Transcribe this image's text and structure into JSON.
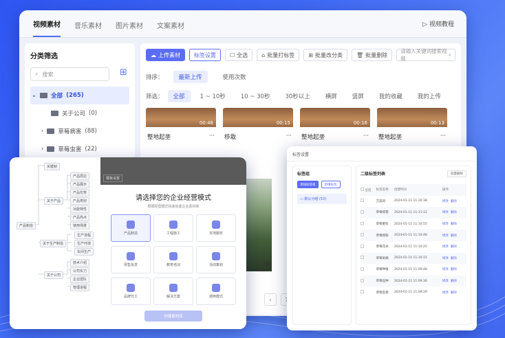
{
  "main": {
    "tabs": [
      "视频素材",
      "音乐素材",
      "图片素材",
      "文案素材"
    ],
    "tutorial": "视频教程",
    "sidebar": {
      "title": "分类筛选",
      "search_placeholder": "搜索",
      "tree": [
        {
          "label": "全部",
          "count": "(265)"
        },
        {
          "label": "关于公司",
          "count": "(0)"
        },
        {
          "label": "草莓病害",
          "count": "(88)"
        },
        {
          "label": "草莓虫害",
          "count": "(22)"
        }
      ]
    },
    "toolbar": {
      "upload": "上传素材",
      "tags": "标签设置",
      "select_all": "全选",
      "batch_tag": "批量打标签",
      "batch_category": "批量改分类",
      "batch_delete": "批量删除",
      "keyword_placeholder": "请输入关键词搜索视频"
    },
    "sort": {
      "label": "排序：",
      "options": [
        "最新上传",
        "使用次数"
      ]
    },
    "filter": {
      "label": "筛选：",
      "options": [
        "全部",
        "1 ~ 10秒",
        "10 ~ 30秒",
        "30秒以上",
        "横屏",
        "竖屏",
        "我的收藏",
        "我的上传"
      ]
    },
    "cards": [
      {
        "name": "整地起垄",
        "duration": "00:46"
      },
      {
        "name": "移栽",
        "duration": "00:15"
      },
      {
        "name": "整地起垄",
        "duration": "00:16"
      },
      {
        "name": "整地起垄",
        "duration": "00:13"
      }
    ],
    "below_text": "果",
    "pager": [
      "‹",
      "1",
      "2"
    ]
  },
  "mind": {
    "root": "产品制造",
    "branches": [
      {
        "label": "关键帧",
        "children": []
      },
      {
        "label": "关于产品",
        "children": [
          "产品周边",
          "产品展示",
          "产品优势",
          "产品类别",
          "功能特性",
          "产品亮点",
          "使用场景"
        ]
      },
      {
        "label": "关于生产制造",
        "children": [
          "生产流程",
          "生产环境",
          "车间生产"
        ]
      },
      {
        "label": "关于公司",
        "children": [
          "技术介绍",
          "公司实力",
          "企业团队",
          "管理进程"
        ]
      }
    ],
    "modal": {
      "header_tag": "模板设置",
      "title": "请选择您的企业经营模式",
      "subtitle": "根据经营模式快速创建企业素材库",
      "options": [
        "产品制造",
        "工程施工",
        "本地服务",
        "零售批发",
        "教育培训",
        "活动策划",
        "品牌代工",
        "解决方案",
        "通用模式"
      ],
      "create": "创建素材库"
    }
  },
  "tags": {
    "title": "标签设置",
    "left_title": "标签组",
    "add_group": "添加标签组",
    "new_tag": "新增标签",
    "group": "默认分组 (53)",
    "right_title": "二级标签列表",
    "batch_delete": "批量删除",
    "columns": [
      "全选",
      "标签名称",
      "创建时间",
      "操作"
    ],
    "rows": [
      {
        "name": "方案同",
        "time": "2024-01-11 11:20:38"
      },
      {
        "name": "草莓病害",
        "time": "2024-01-11 11:11:12"
      },
      {
        "name": "草莓肥料",
        "time": "2024-01-11 11:10:55"
      },
      {
        "name": "草莓授粉",
        "time": "2024-01-11 11:10:48"
      },
      {
        "name": "草莓花朵",
        "time": "2024-01-11 11:10:25"
      },
      {
        "name": "草莓采摘",
        "time": "2024-01-11 11:10:15"
      },
      {
        "name": "草莓种植",
        "time": "2024-01-11 11:09:48"
      },
      {
        "name": "草莓品种",
        "time": "2024-01-11 11:09:36"
      },
      {
        "name": "草莓虫害",
        "time": "2024-01-11 11:09:29"
      }
    ],
    "edit": "修改",
    "delete": "删除"
  }
}
